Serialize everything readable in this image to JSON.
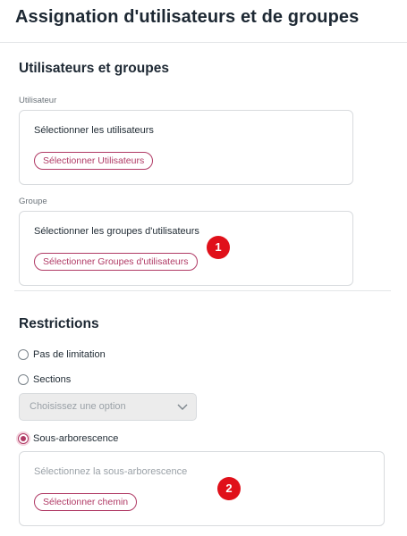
{
  "header": {
    "title": "Assignation d'utilisateurs et de groupes"
  },
  "users_groups": {
    "title": "Utilisateurs et groupes",
    "user": {
      "label": "Utilisateur",
      "prompt": "Sélectionner les utilisateurs",
      "button": "Sélectionner Utilisateurs"
    },
    "group": {
      "label": "Groupe",
      "prompt": "Sélectionner les groupes d'utilisateurs",
      "button": "Sélectionner Groupes d'utilisateurs"
    }
  },
  "restrictions": {
    "title": "Restrictions",
    "options": [
      {
        "label": "Pas de limitation",
        "checked": false
      },
      {
        "label": "Sections",
        "checked": false
      },
      {
        "label": "Sous-arborescence",
        "checked": true
      }
    ],
    "sections_select": {
      "value": "Choisissez une option"
    },
    "subtree": {
      "prompt": "Sélectionnez la sous-arborescence",
      "button": "Sélectionner chemin"
    }
  },
  "markers": [
    "1",
    "2"
  ],
  "colors": {
    "accent": "#b03a65",
    "marker": "#e0101a"
  }
}
